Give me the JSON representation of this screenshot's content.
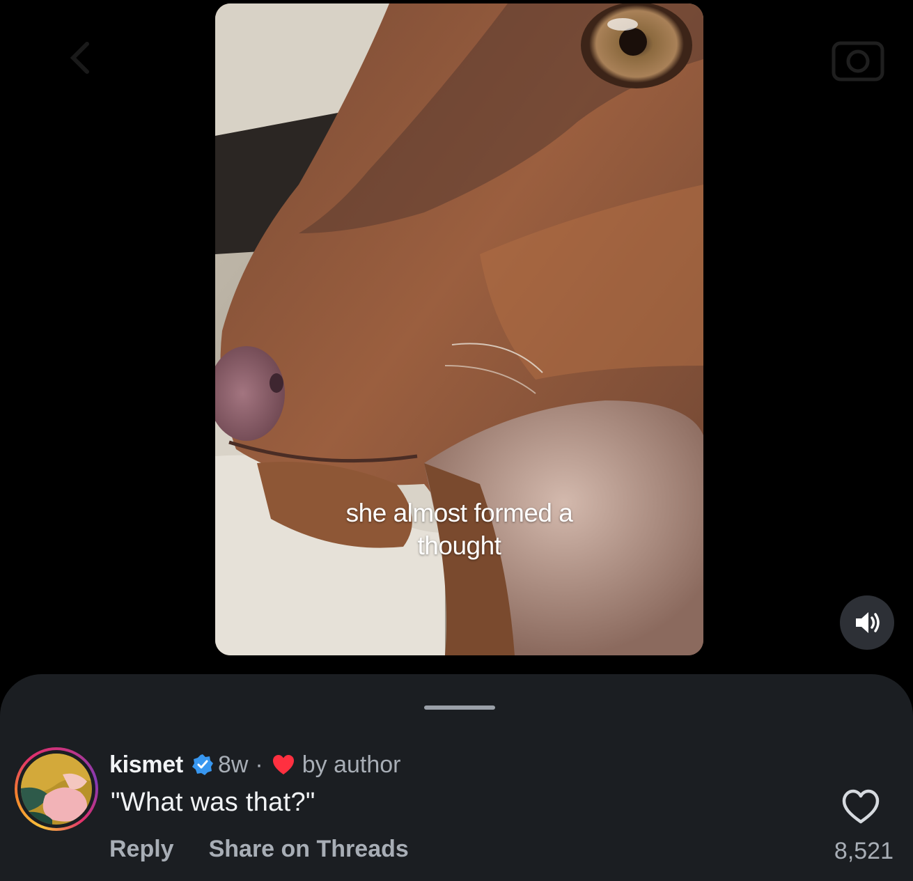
{
  "video": {
    "caption": "she almost formed a thought"
  },
  "comment": {
    "username": "kismet",
    "age": "8w",
    "separator": "·",
    "liked_by": "by author",
    "text": "\"What was that?\"",
    "reply_label": "Reply",
    "share_label": "Share on Threads",
    "like_count": "8,521"
  },
  "colors": {
    "background": "#000000",
    "sheet": "#1b1e22",
    "verified": "#3897f0",
    "heart_author": "#ff3040",
    "muted_text": "#a8aeb6"
  },
  "icons": {
    "sound": "speaker-icon",
    "verified": "verified-badge-icon",
    "author_heart": "heart-filled-icon",
    "like": "heart-outline-icon"
  }
}
